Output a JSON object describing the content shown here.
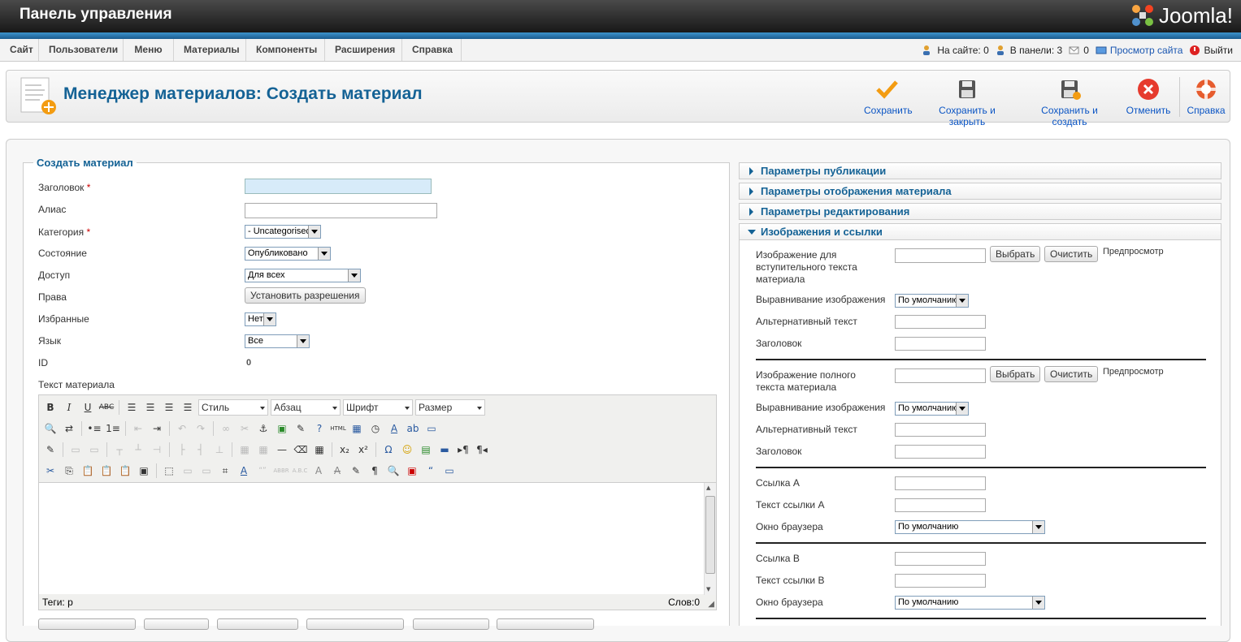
{
  "header": {
    "title": "Панель управления",
    "logo_text": "Joomla!"
  },
  "menu": {
    "items": [
      "Сайт",
      "Пользователи",
      "Меню",
      "Материалы",
      "Компоненты",
      "Расширения",
      "Справка"
    ]
  },
  "status": {
    "on_site": "На сайте: 0",
    "in_panel": "В панели: 3",
    "messages": "0",
    "view_site": "Просмотр сайта",
    "logout": "Выйти"
  },
  "toolbar": {
    "page_title": "Менеджер материалов: Создать материал",
    "save": "Сохранить",
    "save_close": "Сохранить и закрыть",
    "save_new": "Сохранить и создать",
    "cancel": "Отменить",
    "help": "Справка"
  },
  "form": {
    "legend": "Создать материал",
    "title_label": "Заголовок",
    "alias_label": "Алиас",
    "category_label": "Категория",
    "category_value": "- Uncategorised",
    "state_label": "Состояние",
    "state_value": "Опубликовано",
    "access_label": "Доступ",
    "access_value": "Для всех",
    "rights_label": "Права",
    "rights_button": "Установить разрешения",
    "featured_label": "Избранные",
    "featured_value": "Нет",
    "language_label": "Язык",
    "language_value": "Все",
    "id_label": "ID",
    "id_value": "0",
    "text_label": "Текст материала",
    "required_mark": "*"
  },
  "editor": {
    "style": "Стиль",
    "paragraph": "Абзац",
    "font": "Шрифт",
    "size": "Размер",
    "tags": "Теги: p",
    "words": "Слов:0"
  },
  "panels": {
    "publishing": "Параметры публикации",
    "display": "Параметры отображения материала",
    "editing": "Параметры редактирования",
    "images": "Изображения и ссылки"
  },
  "images": {
    "intro_image": "Изображение для вступительного текста материала",
    "full_image": "Изображение полного текста материала",
    "select": "Выбрать",
    "clear": "Очистить",
    "preview": "Предпросмотр",
    "align": "Выравнивание изображения",
    "align_value": "По умолчанию",
    "alt": "Альтернативный текст",
    "caption": "Заголовок",
    "link_a": "Ссылка A",
    "link_a_text": "Текст ссылки A",
    "window": "Окно браузера",
    "window_value": "По умолчанию",
    "link_b": "Ссылка B",
    "link_b_text": "Текст ссылки B"
  }
}
